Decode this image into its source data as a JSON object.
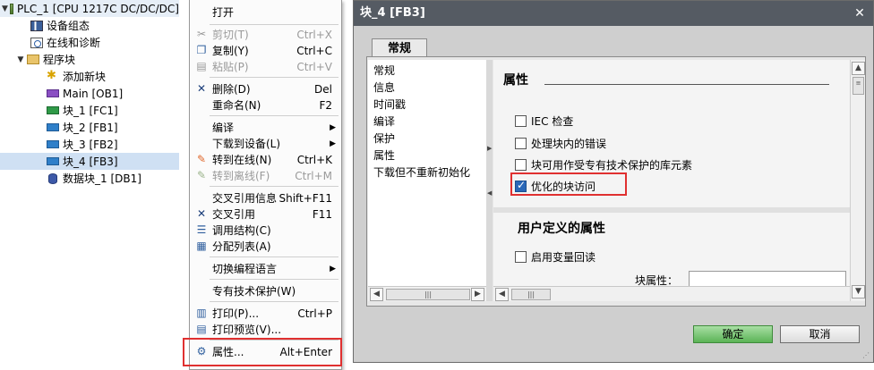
{
  "tree": {
    "items": [
      {
        "label": "PLC_1 [CPU 1217C DC/DC/DC]",
        "icon": "plc-icon",
        "twisty": "▼"
      },
      {
        "label": "设备组态",
        "icon": "device-config-icon",
        "twisty": ""
      },
      {
        "label": "在线和诊断",
        "icon": "online-diagnostics-icon",
        "twisty": ""
      },
      {
        "label": "程序块",
        "icon": "folder-icon",
        "twisty": "▼"
      },
      {
        "label": "添加新块",
        "icon": "add-block-icon",
        "twisty": ""
      },
      {
        "label": "Main [OB1]",
        "icon": "ob-block-icon",
        "twisty": ""
      },
      {
        "label": "块_1 [FC1]",
        "icon": "fc-block-icon",
        "twisty": ""
      },
      {
        "label": "块_2 [FB1]",
        "icon": "fb-block-icon",
        "twisty": ""
      },
      {
        "label": "块_3 [FB2]",
        "icon": "fb-block-icon",
        "twisty": ""
      },
      {
        "label": "块_4 [FB3]",
        "icon": "fb-block-icon",
        "twisty": ""
      },
      {
        "label": "数据块_1 [DB1]",
        "icon": "db-block-icon",
        "twisty": ""
      }
    ]
  },
  "context_menu": {
    "items": [
      {
        "label": "打开",
        "shortcut": "",
        "icon": "",
        "enabled": true,
        "submenu": false
      },
      {
        "label": "剪切(T)",
        "shortcut": "Ctrl+X",
        "icon": "cut-icon",
        "enabled": false,
        "submenu": false
      },
      {
        "label": "复制(Y)",
        "shortcut": "Ctrl+C",
        "icon": "copy-icon",
        "enabled": true,
        "submenu": false
      },
      {
        "label": "粘贴(P)",
        "shortcut": "Ctrl+V",
        "icon": "paste-icon",
        "enabled": false,
        "submenu": false
      },
      {
        "label": "删除(D)",
        "shortcut": "Del",
        "icon": "delete-icon",
        "enabled": true,
        "submenu": false
      },
      {
        "label": "重命名(N)",
        "shortcut": "F2",
        "icon": "",
        "enabled": true,
        "submenu": false
      },
      {
        "label": "编译",
        "shortcut": "",
        "icon": "",
        "enabled": true,
        "submenu": true
      },
      {
        "label": "下载到设备(L)",
        "shortcut": "",
        "icon": "",
        "enabled": true,
        "submenu": true
      },
      {
        "label": "转到在线(N)",
        "shortcut": "Ctrl+K",
        "icon": "go-online-icon",
        "enabled": true,
        "submenu": false
      },
      {
        "label": "转到离线(F)",
        "shortcut": "Ctrl+M",
        "icon": "go-offline-icon",
        "enabled": false,
        "submenu": false
      },
      {
        "label": "交叉引用信息",
        "shortcut": "Shift+F11",
        "icon": "",
        "enabled": true,
        "submenu": false
      },
      {
        "label": "交叉引用",
        "shortcut": "F11",
        "icon": "cross-reference-icon",
        "enabled": true,
        "submenu": false
      },
      {
        "label": "调用结构(C)",
        "shortcut": "",
        "icon": "call-structure-icon",
        "enabled": true,
        "submenu": false
      },
      {
        "label": "分配列表(A)",
        "shortcut": "",
        "icon": "assignment-list-icon",
        "enabled": true,
        "submenu": false
      },
      {
        "label": "切换编程语言",
        "shortcut": "",
        "icon": "",
        "enabled": true,
        "submenu": true
      },
      {
        "label": "专有技术保护(W)",
        "shortcut": "",
        "icon": "",
        "enabled": true,
        "submenu": false
      },
      {
        "label": "打印(P)...",
        "shortcut": "Ctrl+P",
        "icon": "print-icon",
        "enabled": true,
        "submenu": false
      },
      {
        "label": "打印预览(V)...",
        "shortcut": "",
        "icon": "print-preview-icon",
        "enabled": true,
        "submenu": false
      },
      {
        "label": "属性...",
        "shortcut": "Alt+Enter",
        "icon": "properties-icon",
        "enabled": true,
        "submenu": false
      }
    ]
  },
  "dialog": {
    "title": "块_4 [FB3]",
    "close_glyph": "✕",
    "tab_label": "常规",
    "nav_items": [
      "常规",
      "信息",
      "时间戳",
      "编译",
      "保护",
      "属性",
      "下载但不重新初始化"
    ],
    "section_attributes_title": "属性",
    "checkboxes": [
      {
        "label": "IEC 检查",
        "checked": false
      },
      {
        "label": "处理块内的错误",
        "checked": false
      },
      {
        "label": "块可用作受专有技术保护的库元素",
        "checked": false
      },
      {
        "label": "优化的块访问",
        "checked": true
      }
    ],
    "section_user_title": "用户定义的属性",
    "readback_checkbox": {
      "label": "启用变量回读",
      "checked": false
    },
    "block_attr_label": "块属性：",
    "block_attr_value": "",
    "ok_label": "确定",
    "cancel_label": "取消",
    "scroll_thumb_glyph": "|||"
  },
  "colors": {
    "highlight_border": "#e03030",
    "title_bar": "#555b63",
    "ok_button": "#5bb356",
    "selection": "#cfe0f3"
  }
}
